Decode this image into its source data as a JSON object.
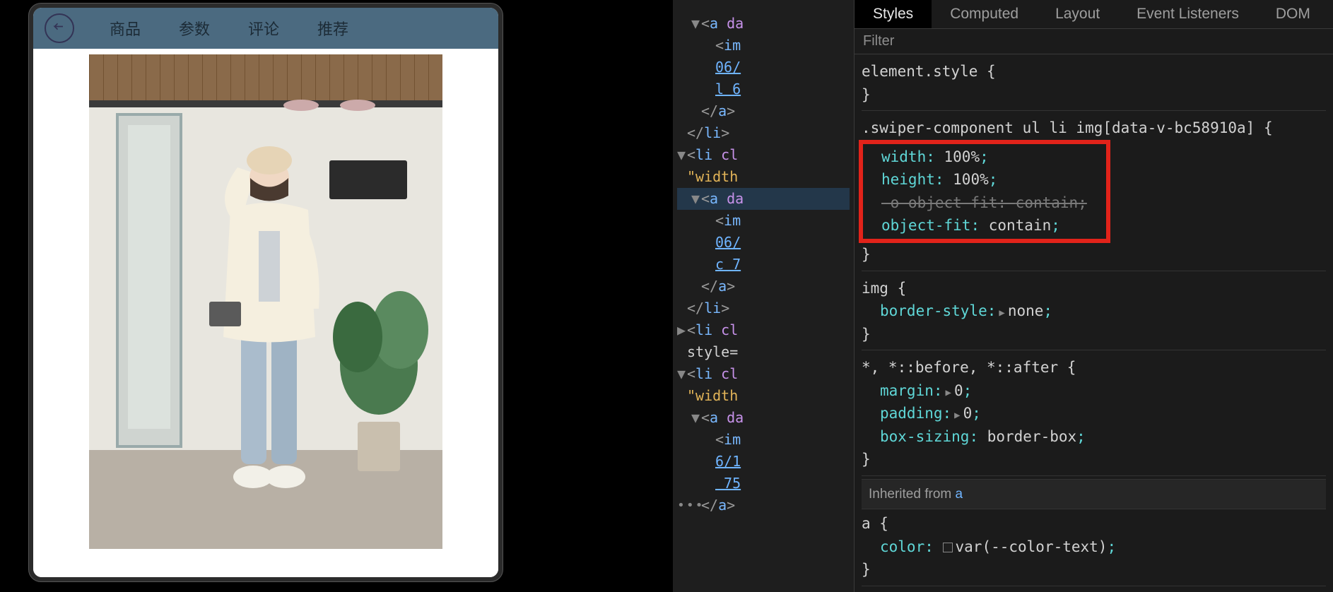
{
  "mobile": {
    "tabs": [
      "商品",
      "参数",
      "评论",
      "推荐"
    ]
  },
  "elements": {
    "lines": [
      {
        "indent": 1,
        "twisty": "▼",
        "html": "<a da"
      },
      {
        "indent": 2,
        "twisty": "",
        "html": "<im"
      },
      {
        "indent": 2,
        "twisty": "",
        "link": "06/"
      },
      {
        "indent": 2,
        "twisty": "",
        "link": "l 6"
      },
      {
        "indent": 1,
        "twisty": "",
        "html": "</a>"
      },
      {
        "indent": 0,
        "twisty": "",
        "html": "</li>"
      },
      {
        "indent": 0,
        "twisty": "▼",
        "html": "<li cl"
      },
      {
        "indent": 0,
        "twisty": "",
        "attr": "\"width"
      },
      {
        "indent": 1,
        "twisty": "▼",
        "html": "<a da",
        "selected": true
      },
      {
        "indent": 2,
        "twisty": "",
        "html": "<im"
      },
      {
        "indent": 2,
        "twisty": "",
        "link": "06/"
      },
      {
        "indent": 2,
        "twisty": "",
        "link": "c 7"
      },
      {
        "indent": 1,
        "twisty": "",
        "html": "</a>"
      },
      {
        "indent": 0,
        "twisty": "",
        "html": "</li>"
      },
      {
        "indent": 0,
        "twisty": "▶",
        "html": "<li cl"
      },
      {
        "indent": 0,
        "twisty": "",
        "plain": "style="
      },
      {
        "indent": 0,
        "twisty": "▼",
        "html": "<li cl"
      },
      {
        "indent": 0,
        "twisty": "",
        "attr": "\"width"
      },
      {
        "indent": 1,
        "twisty": "▼",
        "html": "<a da"
      },
      {
        "indent": 2,
        "twisty": "",
        "html": "<im"
      },
      {
        "indent": 2,
        "twisty": "",
        "link": "6/1"
      },
      {
        "indent": 2,
        "twisty": "",
        "link": " 75"
      },
      {
        "indent": 1,
        "twisty": "",
        "html": "</a>"
      }
    ]
  },
  "stylesTabs": [
    "Styles",
    "Computed",
    "Layout",
    "Event Listeners",
    "DOM"
  ],
  "filterPlaceholder": "Filter",
  "rules": {
    "elementStyle": {
      "selector": "element.style",
      "decls": []
    },
    "swiper": {
      "selector": ".swiper-component ul li img[data-v-bc58910a]",
      "decls": [
        {
          "name": "width",
          "value": "100%",
          "hl": true
        },
        {
          "name": "height",
          "value": "100%",
          "hl": true
        },
        {
          "name": "-o-object-fit",
          "value": "contain",
          "hl": true,
          "struck": true
        },
        {
          "name": "object-fit",
          "value": "contain",
          "hl": true
        }
      ]
    },
    "img": {
      "selector": "img",
      "decls": [
        {
          "name": "border-style",
          "value": "none",
          "tri": true
        }
      ]
    },
    "universal": {
      "selector": "*, *::before, *::after",
      "decls": [
        {
          "name": "margin",
          "value": "0",
          "tri": true
        },
        {
          "name": "padding",
          "value": "0",
          "tri": true
        },
        {
          "name": "box-sizing",
          "value": "border-box"
        }
      ]
    },
    "inheritedFrom": "a",
    "aRule": {
      "selector": "a",
      "decls": [
        {
          "name": "color",
          "value": "var(--color-text)",
          "swatch": true
        }
      ]
    }
  }
}
